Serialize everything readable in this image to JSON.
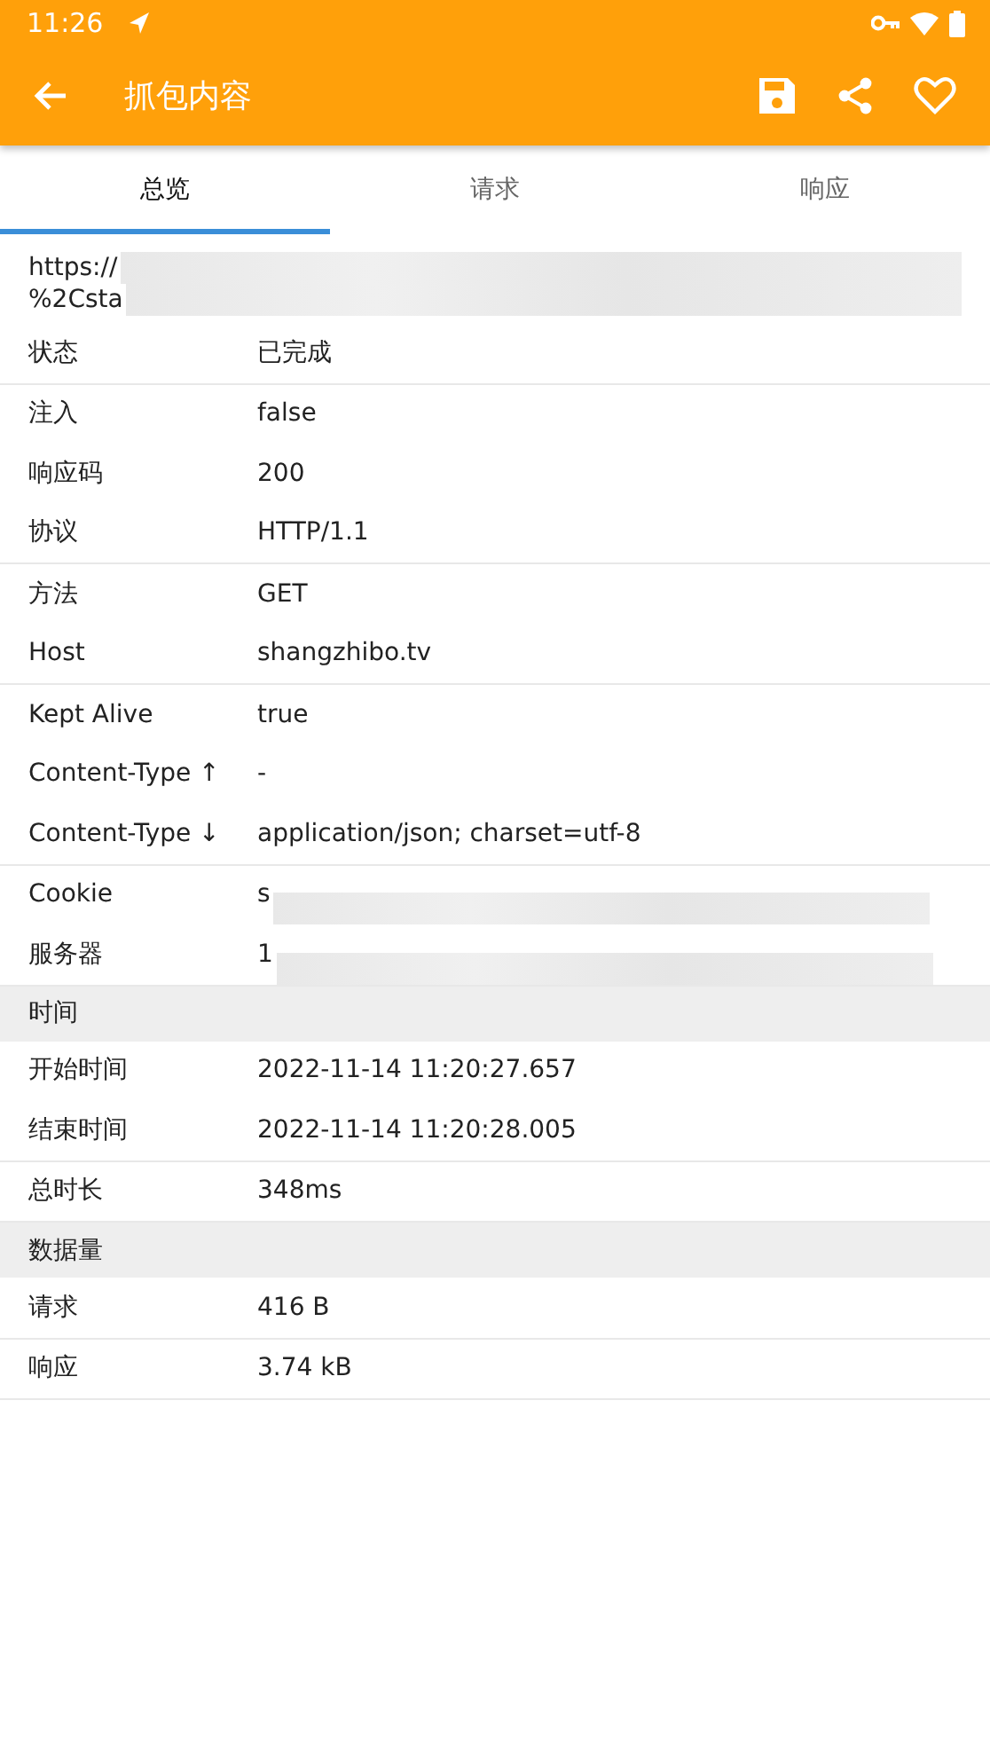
{
  "status_bar": {
    "time": "11:26"
  },
  "app_bar": {
    "title": "抓包内容"
  },
  "tabs": [
    {
      "label": "总览",
      "selected": true
    },
    {
      "label": "请求",
      "selected": false
    },
    {
      "label": "响应",
      "selected": false
    }
  ],
  "url": {
    "lines": [
      "https://",
      "%2Csta"
    ],
    "redacted": true
  },
  "sections": [
    {
      "groups": [
        [
          {
            "label": "状态",
            "value": "已完成",
            "redacted": false
          }
        ],
        [
          {
            "label": "注入",
            "value": "false",
            "redacted": false
          },
          {
            "label": "响应码",
            "value": "200",
            "redacted": false
          },
          {
            "label": "协议",
            "value": "HTTP/1.1",
            "redacted": false
          }
        ],
        [
          {
            "label": "方法",
            "value": "GET",
            "redacted": false
          },
          {
            "label": "Host",
            "value": "shangzhibo.tv",
            "redacted": false
          }
        ],
        [
          {
            "label": "Kept Alive",
            "value": "true",
            "redacted": false
          },
          {
            "label": "Content-Type ↑",
            "value": "-",
            "redacted": false
          },
          {
            "label": "Content-Type ↓",
            "value": "application/json; charset=utf-8",
            "redacted": false
          }
        ],
        [
          {
            "label": "Cookie",
            "value": "s",
            "redacted": true
          },
          {
            "label": "服务器",
            "value": "1",
            "redacted": true
          }
        ]
      ]
    },
    {
      "header": "时间",
      "groups": [
        [
          {
            "label": "开始时间",
            "value": "2022-11-14 11:20:27.657",
            "redacted": false
          },
          {
            "label": "结束时间",
            "value": "2022-11-14 11:20:28.005",
            "redacted": false
          }
        ],
        [
          {
            "label": "总时长",
            "value": "348ms",
            "redacted": false
          }
        ]
      ]
    },
    {
      "header": "数据量",
      "groups": [
        [
          {
            "label": "请求",
            "value": "416 B",
            "redacted": false
          }
        ],
        [
          {
            "label": "响应",
            "value": "3.74 kB",
            "redacted": false
          }
        ]
      ]
    }
  ]
}
